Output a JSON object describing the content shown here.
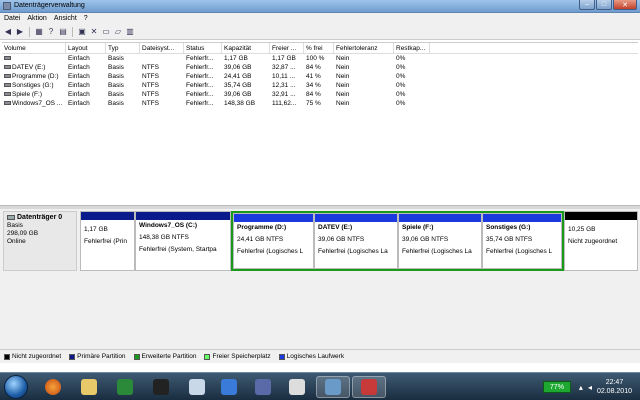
{
  "window": {
    "title": "Datenträgerverwaltung"
  },
  "menu": [
    "Datei",
    "Aktion",
    "Ansicht",
    "?"
  ],
  "toolbar": [
    "back-icon",
    "forward-icon",
    "grid-icon",
    "help-icon",
    "properties-icon",
    "disk-icon",
    "delete-icon",
    "folder-icon",
    "folder-open-icon",
    "properties-icon"
  ],
  "columns": [
    "Volume",
    "Layout",
    "Typ",
    "Dateisyst...",
    "Status",
    "Kapazität",
    "Freier ...",
    "% frei",
    "Fehlertoleranz",
    "Restkap..."
  ],
  "volumes": [
    [
      "",
      "Einfach",
      "Basis",
      "",
      "Fehlerfr...",
      "1,17 GB",
      "1,17 GB",
      "100 %",
      "Nein",
      "0%"
    ],
    [
      "DATEV (E:)",
      "Einfach",
      "Basis",
      "NTFS",
      "Fehlerfr...",
      "39,06 GB",
      "32,87 ...",
      "84 %",
      "Nein",
      "0%"
    ],
    [
      "Programme (D:)",
      "Einfach",
      "Basis",
      "NTFS",
      "Fehlerfr...",
      "24,41 GB",
      "10,11 ...",
      "41 %",
      "Nein",
      "0%"
    ],
    [
      "Sonstiges (G:)",
      "Einfach",
      "Basis",
      "NTFS",
      "Fehlerfr...",
      "35,74 GB",
      "12,31 ...",
      "34 %",
      "Nein",
      "0%"
    ],
    [
      "Spiele (F:)",
      "Einfach",
      "Basis",
      "NTFS",
      "Fehlerfr...",
      "39,06 GB",
      "32,91 ...",
      "84 %",
      "Nein",
      "0%"
    ],
    [
      "Windows7_OS ...",
      "Einfach",
      "Basis",
      "NTFS",
      "Fehlerfr...",
      "148,38 GB",
      "111,62...",
      "75 %",
      "Nein",
      "0%"
    ]
  ],
  "disk": {
    "name": "Datenträger 0",
    "type": "Basis",
    "size": "298,09 GB",
    "status": "Online"
  },
  "partitions": {
    "p1": {
      "name": "",
      "size": "1,17 GB",
      "status": "Fehlerfrei (Prin"
    },
    "p2": {
      "name": "Windows7_OS  (C:)",
      "size": "148,38 GB NTFS",
      "status": "Fehlerfrei (System, Startpa"
    },
    "p3": {
      "name": "Programme  (D:)",
      "size": "24,41 GB NTFS",
      "status": "Fehlerfrei (Logisches L"
    },
    "p4": {
      "name": "DATEV  (E:)",
      "size": "39,06 GB NTFS",
      "status": "Fehlerfrei (Logisches La"
    },
    "p5": {
      "name": "Spiele  (F:)",
      "size": "39,06 GB NTFS",
      "status": "Fehlerfrei (Logisches La"
    },
    "p6": {
      "name": "Sonstiges  (G:)",
      "size": "35,74 GB NTFS",
      "status": "Fehlerfrei (Logisches L"
    },
    "p7": {
      "name": "",
      "size": "10,25 GB",
      "status": "Nicht zugeordnet"
    }
  },
  "legend": [
    {
      "label": "Nicht zugeordnet",
      "color": "#000000"
    },
    {
      "label": "Primäre Partition",
      "color": "#0a1a8a"
    },
    {
      "label": "Erweiterte Partition",
      "color": "#1a9a1a"
    },
    {
      "label": "Freier Speicherplatz",
      "color": "#66ff66"
    },
    {
      "label": "Logisches Laufwerk",
      "color": "#1a3ae0"
    }
  ],
  "taskbar": {
    "battery": "77%",
    "time": "22:47",
    "date": "02.08.2010"
  }
}
